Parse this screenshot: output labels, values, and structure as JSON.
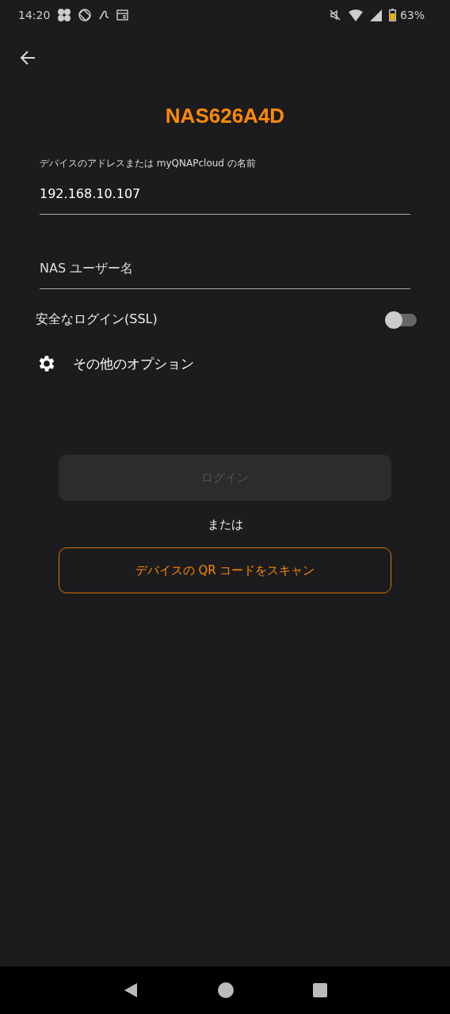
{
  "status_bar": {
    "time": "14:20",
    "battery": "63%"
  },
  "title": "NAS626A4D",
  "address_field": {
    "label": "デバイスのアドレスまたは myQNAPcloud の名前",
    "value": "192.168.10.107"
  },
  "username_field": {
    "placeholder": "NAS ユーザー名"
  },
  "ssl_toggle": {
    "label": "安全なログイン(SSL)",
    "on": false
  },
  "more_options": {
    "label": "その他のオプション"
  },
  "login_button": {
    "label": "ログイン",
    "disabled": true
  },
  "or_text": "または",
  "scan_button": {
    "label": "デバイスの QR コードをスキャン"
  }
}
